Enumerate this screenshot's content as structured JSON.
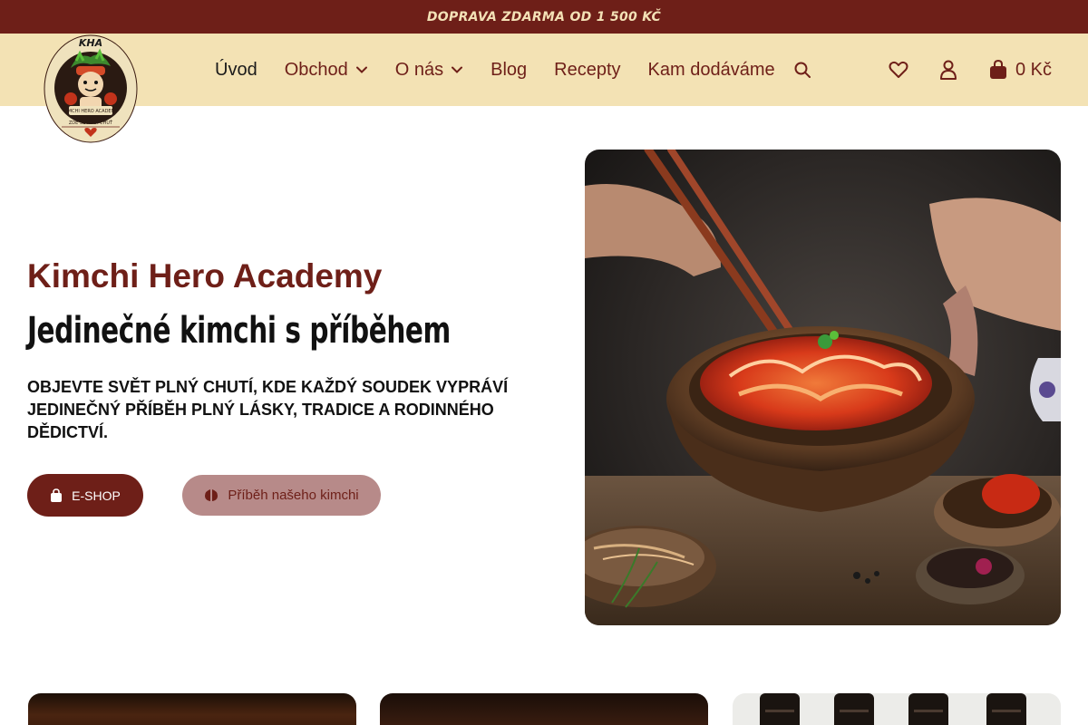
{
  "topbar": {
    "text": "DOPRAVA ZDARMA OD 1 500 KČ"
  },
  "logo": {
    "icon": "kha-logo"
  },
  "nav": {
    "items": [
      {
        "label": "Úvod",
        "active": true,
        "dropdown": false
      },
      {
        "label": "Obchod",
        "active": false,
        "dropdown": true
      },
      {
        "label": "O nás",
        "active": false,
        "dropdown": true
      },
      {
        "label": "Blog",
        "active": false,
        "dropdown": false
      },
      {
        "label": "Recepty",
        "active": false,
        "dropdown": false
      },
      {
        "label": "Kam dodáváme",
        "active": false,
        "dropdown": false
      }
    ],
    "search_icon": "search-icon"
  },
  "header_icons": {
    "wishlist": "heart-icon",
    "account": "user-icon",
    "cart": "bag-icon",
    "cart_total": "0 Kč"
  },
  "hero": {
    "brand": "Kimchi Hero Academy",
    "title": "Jedinečné kimchi s příběhem",
    "subtitle": "Objevte svět plný chutí, kde každý soudek vypráví jedinečný příběh plný lásky, tradice a rodinného dědictví.",
    "buttons": {
      "shop_label": "E-SHOP",
      "story_label": "Příběh našeho kimchi"
    },
    "image": "kimchi-bowl-photo"
  },
  "colors": {
    "brand": "#6e1f18",
    "header_bg": "#f3e2b4",
    "accent_text": "#f3e1b6",
    "secondary_button": "#b78a89"
  }
}
